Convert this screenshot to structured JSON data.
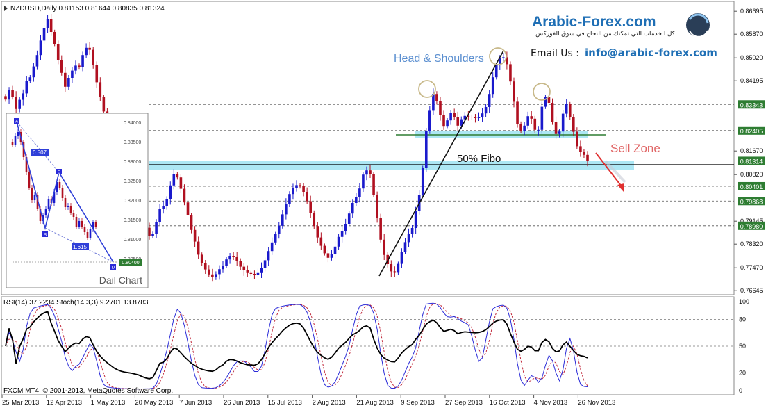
{
  "header": {
    "symbol_line": "NZDUSD,Daily  0.81153 0.81644 0.80835 0.81324"
  },
  "brand": {
    "logo_text": "Arabic-Forex.com",
    "tagline": "كل الخدمات التي تمكنك من النجاح في سوق الفوركس",
    "email_label": "Email Us :",
    "email": "info@arabic-forex.com"
  },
  "annotations": {
    "head_shoulders": "Head & Shoulders",
    "fibo": "50% Fibo",
    "sell_zone": "Sell Zone"
  },
  "inset": {
    "caption": "Dail Chart",
    "points": [
      "A",
      "B",
      "C",
      "D"
    ],
    "ratio1": "0.507",
    "ratio2": "1.615",
    "price_tag": "0.80400",
    "ticks": [
      "0.84000",
      "0.83500",
      "0.83000",
      "0.82500",
      "0.82000",
      "0.81500",
      "0.81000",
      "0.80500"
    ]
  },
  "indicator": {
    "label": "RSI(14) 37.2234  Stoch(14,3,3) 9.2701 13.8783",
    "copyright": "FXCM MT4, © 2001-2013, MetaQuotes Software Corp.",
    "levels": [
      "100",
      "80",
      "50",
      "20",
      "0"
    ]
  },
  "colors": {
    "bull": "#1a1acc",
    "bear": "#b01020",
    "zone": "#9fe3f2",
    "rsi": "#000000",
    "stoch_main": "#2a2ad8",
    "stoch_signal": "#c0283a",
    "support_green": "#2e7d32",
    "arrow": "#e03030",
    "brand_blue": "#1f6fb5"
  },
  "chart_data": {
    "type": "candlestick",
    "symbol": "NZDUSD",
    "timeframe": "Daily",
    "ylim": [
      0.766,
      0.869
    ],
    "y_ticks": [
      "0.86695",
      "0.85870",
      "0.85020",
      "0.84195",
      "0.83343",
      "0.82405",
      "0.81670",
      "0.81314",
      "0.80820",
      "0.80401",
      "0.79868",
      "0.79145",
      "0.78980",
      "0.78320",
      "0.77470",
      "0.76645"
    ],
    "x_ticks": [
      "25 Mar 2013",
      "12 Apr 2013",
      "1 May 2013",
      "20 May 2013",
      "7 Jun 2013",
      "26 Jun 2013",
      "15 Jul 2013",
      "2 Aug 2013",
      "21 Aug 2013",
      "9 Sep 2013",
      "27 Sep 2013",
      "16 Oct 2013",
      "4 Nov 2013",
      "26 Nov 2013"
    ],
    "highlighted_levels": [
      {
        "label": "0.83343",
        "value": 0.83343
      },
      {
        "label": "0.82405",
        "value": 0.82405
      },
      {
        "label": "0.81314",
        "value": 0.81314
      },
      {
        "label": "0.80401",
        "value": 0.80401
      },
      {
        "label": "0.79868",
        "value": 0.79868
      },
      {
        "label": "0.78980",
        "value": 0.7898
      }
    ],
    "closes": [
      0.8352,
      0.8385,
      0.8362,
      0.8318,
      0.8351,
      0.8374,
      0.8418,
      0.8432,
      0.8471,
      0.8512,
      0.8564,
      0.861,
      0.8642,
      0.8595,
      0.8552,
      0.8495,
      0.8448,
      0.8398,
      0.843,
      0.8456,
      0.8474,
      0.847,
      0.8512,
      0.8538,
      0.8531,
      0.8475,
      0.8414,
      0.836,
      0.8309,
      0.8262,
      0.8213,
      0.8159,
      0.8117,
      0.8082,
      0.8059,
      0.8044,
      0.803,
      0.8009,
      0.7984,
      0.7935,
      0.7891,
      0.7862,
      0.7869,
      0.791,
      0.796,
      0.7968,
      0.7994,
      0.8043,
      0.8084,
      0.8072,
      0.8031,
      0.7982,
      0.7935,
      0.7883,
      0.7841,
      0.7794,
      0.7763,
      0.7741,
      0.7723,
      0.7715,
      0.7724,
      0.7742,
      0.7754,
      0.7777,
      0.7788,
      0.7785,
      0.7771,
      0.7751,
      0.7738,
      0.7728,
      0.7725,
      0.7722,
      0.7728,
      0.7746,
      0.7774,
      0.7807,
      0.7838,
      0.7868,
      0.7898,
      0.7939,
      0.7977,
      0.8012,
      0.8035,
      0.8044,
      0.804,
      0.802,
      0.7986,
      0.7943,
      0.7897,
      0.7856,
      0.7826,
      0.7799,
      0.7783,
      0.7796,
      0.7823,
      0.7858,
      0.788,
      0.7905,
      0.7942,
      0.798,
      0.8,
      0.8032,
      0.8082,
      0.8097,
      0.8084,
      0.8009,
      0.7925,
      0.7848,
      0.7793,
      0.776,
      0.7734,
      0.7729,
      0.7761,
      0.7805,
      0.7839,
      0.7868,
      0.789,
      0.7952,
      0.8008,
      0.8106,
      0.8238,
      0.8314,
      0.8372,
      0.8346,
      0.8296,
      0.8257,
      0.8277,
      0.8303,
      0.8288,
      0.8258,
      0.8281,
      0.8293,
      0.829,
      0.8288,
      0.8285,
      0.829,
      0.8302,
      0.8325,
      0.8372,
      0.8432,
      0.8475,
      0.85,
      0.8504,
      0.8479,
      0.8417,
      0.8344,
      0.8265,
      0.824,
      0.8258,
      0.8292,
      0.8283,
      0.8243,
      0.8243,
      0.8326,
      0.8362,
      0.834,
      0.8271,
      0.8228,
      0.8237,
      0.8301,
      0.8335,
      0.8288,
      0.8236,
      0.8184,
      0.8164,
      0.8153,
      0.8132
    ]
  }
}
